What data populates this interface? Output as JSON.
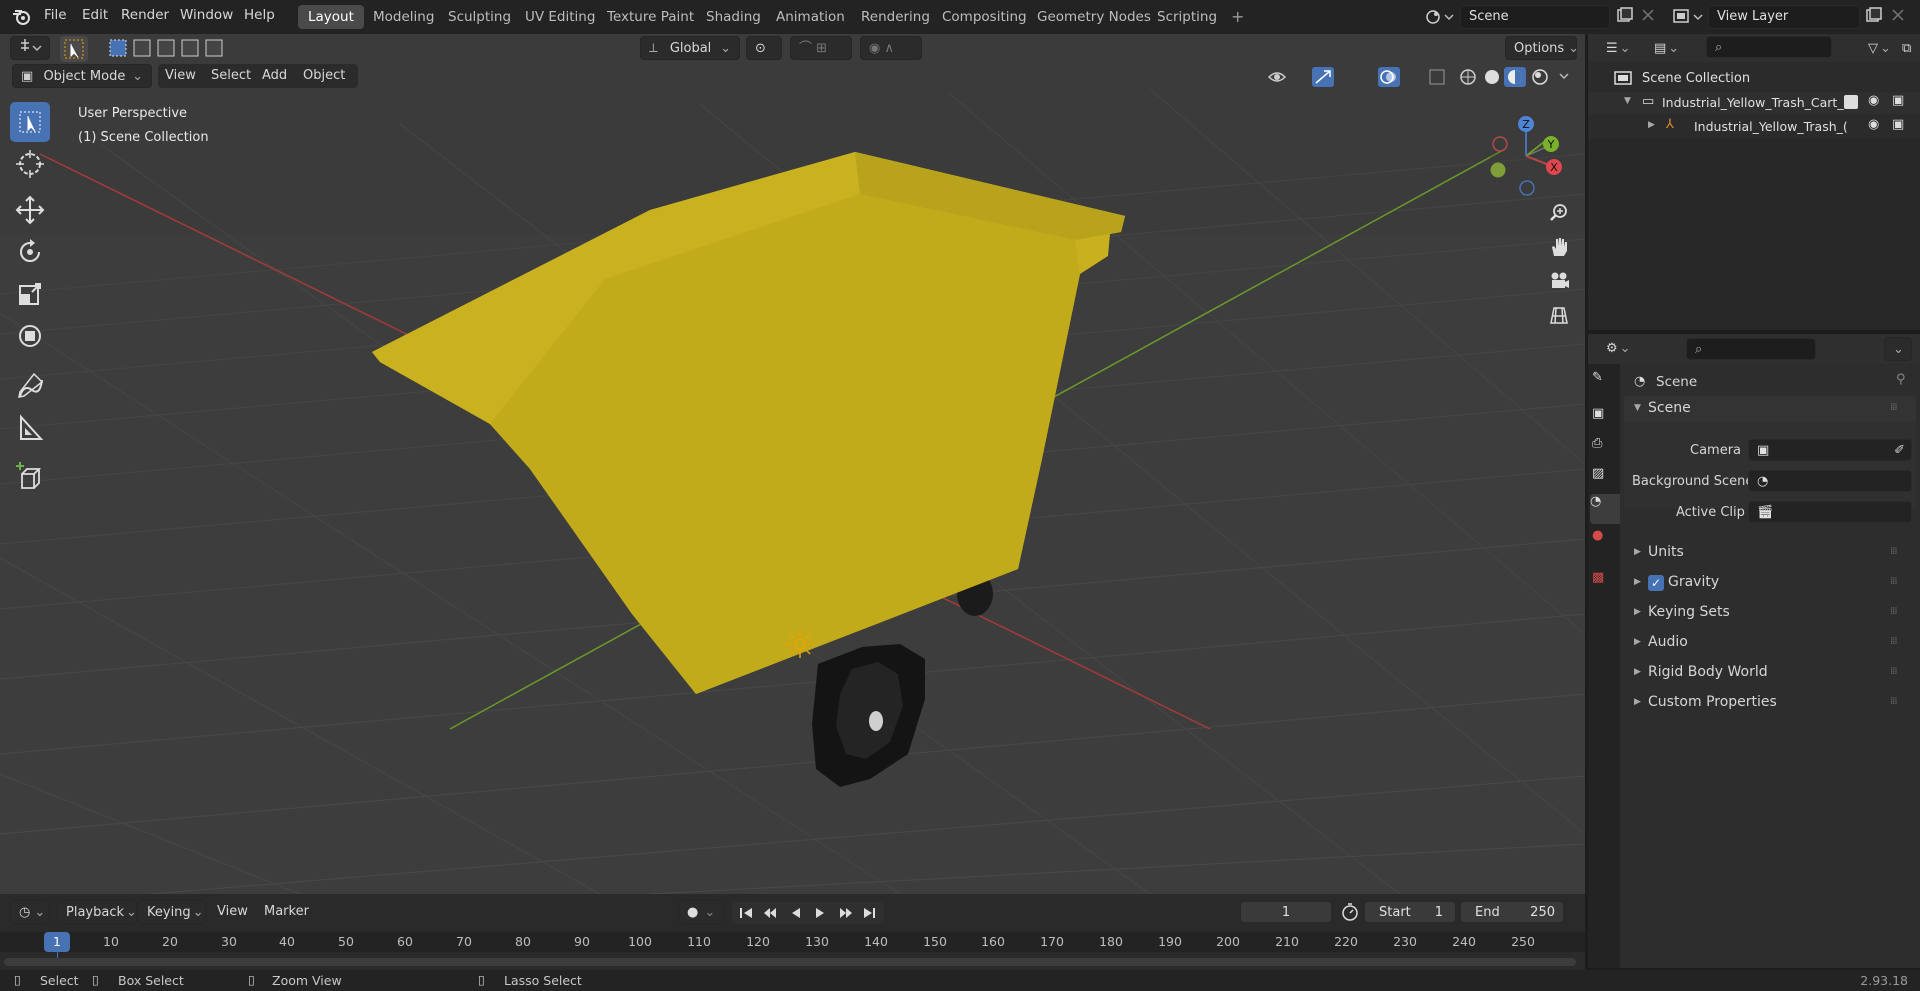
{
  "topbar": {
    "menus": [
      "File",
      "Edit",
      "Render",
      "Window",
      "Help"
    ],
    "workspaces": [
      "Layout",
      "Modeling",
      "Sculpting",
      "UV Editing",
      "Texture Paint",
      "Shading",
      "Animation",
      "Rendering",
      "Compositing",
      "Geometry Nodes",
      "Scripting"
    ],
    "active_workspace": "Layout",
    "add_tab": "+",
    "scene": "Scene",
    "view_layer": "View Layer"
  },
  "viewport_header": {
    "mode": "Object Mode",
    "menus": [
      "View",
      "Select",
      "Add",
      "Object"
    ],
    "transform_orientation": "Global",
    "options": "Options"
  },
  "viewport": {
    "perspective": "User Perspective",
    "collection": "(1) Scene Collection",
    "gizmo_axes": [
      "X",
      "Y",
      "Z"
    ]
  },
  "timeline": {
    "menus": [
      "Playback",
      "Keying",
      "View",
      "Marker"
    ],
    "current_frame": "1",
    "start_label": "Start",
    "start": "1",
    "end_label": "End",
    "end": "250",
    "ruler": [
      "1",
      "10",
      "20",
      "30",
      "40",
      "50",
      "60",
      "70",
      "80",
      "90",
      "100",
      "110",
      "120",
      "130",
      "140",
      "150",
      "160",
      "170",
      "180",
      "190",
      "200",
      "210",
      "220",
      "230",
      "240",
      "250"
    ]
  },
  "statusbar": {
    "select": "Select",
    "box_select": "Box Select",
    "zoom_view": "Zoom View",
    "lasso_select": "Lasso Select",
    "version": "2.93.18"
  },
  "outliner": {
    "root": "Scene Collection",
    "items": [
      {
        "label": "Industrial_Yellow_Trash_Cart_"
      },
      {
        "label": "Industrial_Yellow_Trash_("
      }
    ]
  },
  "properties": {
    "context": "Scene",
    "panel": "Scene",
    "fields": {
      "camera": "Camera",
      "background_scene": "Background Scene",
      "active_clip": "Active Clip"
    },
    "sections": [
      "Units",
      "Gravity",
      "Keying Sets",
      "Audio",
      "Rigid Body World",
      "Custom Properties"
    ],
    "gravity_checked": true
  },
  "colors": {
    "accent": "#4772b3",
    "cart_yellow": "#c8b01e",
    "grid_red": "#a63a3a",
    "grid_green": "#6b9a2a"
  }
}
